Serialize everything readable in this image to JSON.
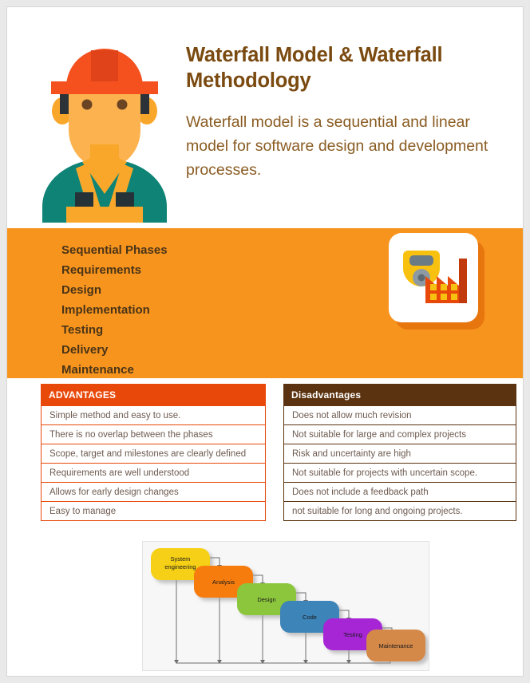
{
  "hero": {
    "title": "Waterfall Model & Waterfall Methodology",
    "subtitle": "Waterfall model is a sequential and linear model for software design and development processes.",
    "illustration_name": "construction-worker-avatar",
    "colors": {
      "title": "#7a4a10",
      "subtitle": "#8a5c22",
      "helmet": "#f4511e",
      "skin": "#fcb34f",
      "shirt": "#0f8476",
      "vest": "#f9a72b"
    }
  },
  "banner": {
    "background": "#f7941e",
    "phases": [
      {
        "label": "Sequential Phases"
      },
      {
        "label": "Requirements"
      },
      {
        "label": "Design"
      },
      {
        "label": "Implementation"
      },
      {
        "label": "Testing"
      },
      {
        "label": "Delivery"
      },
      {
        "label": "Maintenance"
      }
    ],
    "icon_card": {
      "name": "factory-gasmask-icon",
      "card_background": "#ffffff",
      "shadow_color": "#e8760f",
      "mask_color": "#f9c10f",
      "factory_color": "#e8490b"
    }
  },
  "tables": {
    "advantages": {
      "header": "ADVANTAGES",
      "header_background": "#e8490b",
      "border_color": "#e8490b",
      "rows": [
        "Simple method and easy to use.",
        "There is no overlap between the phases",
        "Scope, target and milestones are clearly defined",
        "Requirements are well understood",
        "Allows for early design changes",
        "Easy to manage"
      ]
    },
    "disadvantages": {
      "header": "Disadvantages",
      "header_background": "#5b3310",
      "border_color": "#5b3310",
      "rows": [
        "Does not allow much revision",
        "Not suitable for large and complex projects",
        "Risk and uncertainty are high",
        "Not suitable for projects with uncertain scope.",
        "Does not include a feedback path",
        "not suitable for long and ongoing projects."
      ]
    }
  },
  "diagram": {
    "name": "waterfall-phases-diagram",
    "background": "#f7f7f7",
    "stages": [
      {
        "label_line1": "System",
        "label_line2": "engineering",
        "color": "#f5d014"
      },
      {
        "label_line1": "Analysis",
        "label_line2": "",
        "color": "#f57c0d"
      },
      {
        "label_line1": "Design",
        "label_line2": "",
        "color": "#8cc63e"
      },
      {
        "label_line1": "Code",
        "label_line2": "",
        "color": "#3d84b8"
      },
      {
        "label_line1": "Testing",
        "label_line2": "",
        "color": "#a626d6"
      },
      {
        "label_line1": "Maintenance",
        "label_line2": "",
        "color": "#d4894a"
      }
    ]
  }
}
